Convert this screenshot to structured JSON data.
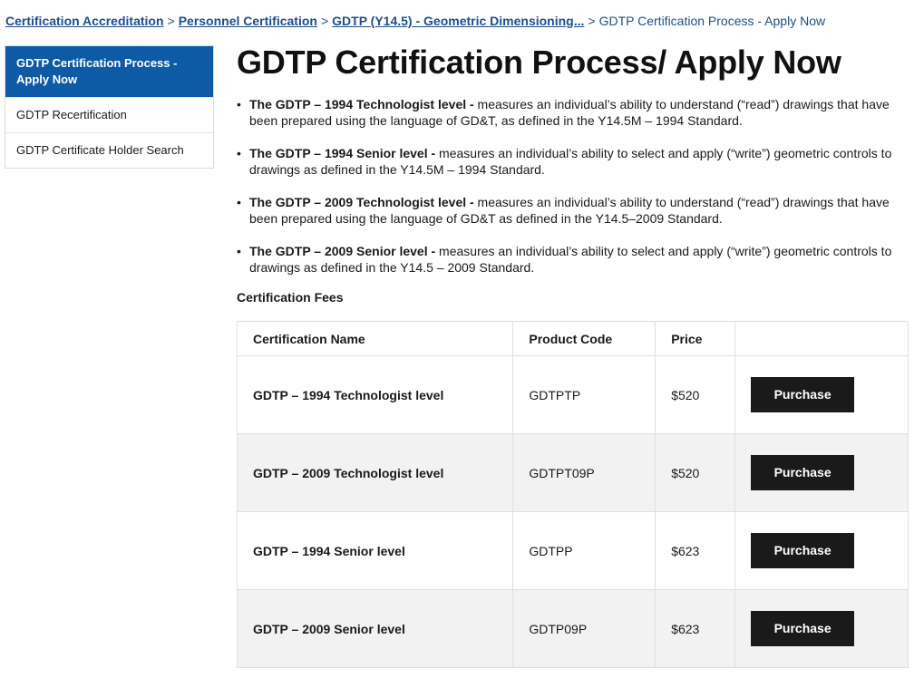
{
  "breadcrumb": {
    "items": [
      "Certification Accreditation",
      "Personnel Certification",
      "GDTP (Y14.5) - Geometric Dimensioning..."
    ],
    "separator": ">",
    "current": "GDTP Certification Process - Apply Now"
  },
  "sidebar": {
    "items": [
      {
        "label": "GDTP Certification Process - Apply Now",
        "active": true
      },
      {
        "label": "GDTP Recertification",
        "active": false
      },
      {
        "label": "GDTP Certificate Holder Search",
        "active": false
      }
    ]
  },
  "main": {
    "title": "GDTP Certification Process/ Apply Now",
    "levels": [
      {
        "lead": "The GDTP – 1994 Technologist level -",
        "text": " measures an individual’s ability to understand (“read”) drawings that have been prepared using the language of GD&T, as defined in the Y14.5M – 1994 Standard."
      },
      {
        "lead": "The GDTP – 1994 Senior level -",
        "text": " measures an individual’s ability to select and apply (“write”) geometric controls to drawings as defined in the Y14.5M – 1994 Standard."
      },
      {
        "lead": "The GDTP – 2009 Technologist level -",
        "text": " measures an individual’s ability to understand (“read”) drawings that have been prepared using the language of GD&T as defined in the Y14.5–2009 Standard."
      },
      {
        "lead": "The GDTP – 2009 Senior level -",
        "text": " measures an individual’s ability to select and apply (“write”) geometric controls to drawings as defined in the Y14.5 – 2009 Standard."
      }
    ],
    "fees_title": "Certification Fees",
    "table": {
      "headers": [
        "Certification Name",
        "Product Code",
        "Price",
        ""
      ],
      "rows": [
        {
          "name": "GDTP – 1994 Technologist level",
          "code": "GDTPTP",
          "price": "$520",
          "action": "Purchase"
        },
        {
          "name": "GDTP – 2009 Technologist level",
          "code": "GDTPT09P",
          "price": "$520",
          "action": "Purchase"
        },
        {
          "name": "GDTP – 1994 Senior level",
          "code": "GDTPP",
          "price": "$623",
          "action": "Purchase"
        },
        {
          "name": "GDTP – 2009 Senior level",
          "code": "GDTP09P",
          "price": "$623",
          "action": "Purchase"
        }
      ]
    }
  },
  "colors": {
    "accent": "#0d5aa7",
    "link": "#1f4e8c",
    "button": "#1a1a1a",
    "row_alt": "#f2f2f2"
  }
}
